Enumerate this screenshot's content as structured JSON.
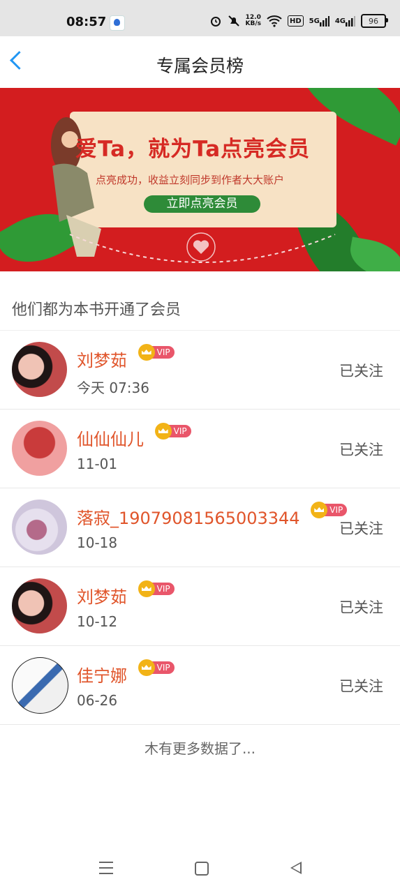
{
  "statusbar": {
    "time": "08:57",
    "speed": "12.0\nKB/s",
    "network1": "5G",
    "network2": "4G",
    "hd": "HD",
    "battery": "96",
    "icons": [
      "baidu-app-icon",
      "alarm-icon",
      "mute-icon",
      "wifi-icon",
      "hd-icon",
      "signal-5g-icon",
      "signal-4g-icon",
      "battery-icon"
    ]
  },
  "header": {
    "title": "专属会员榜",
    "back_icon": "chevron-left-icon"
  },
  "banner": {
    "headline": "爱Ta，就为Ta点亮会员",
    "subtitle": "点亮成功，收益立刻同步到作者大大账户",
    "button": "立即点亮会员"
  },
  "section": {
    "title": "他们都为本书开通了会员"
  },
  "vip_label": "VIP",
  "members": [
    {
      "name": "刘梦茹",
      "date": "今天 07:36",
      "status": "已关注",
      "avatar_colors": [
        "#3a2222",
        "#c24b4b"
      ]
    },
    {
      "name": "仙仙仙儿",
      "date": "11-01",
      "status": "已关注",
      "avatar_colors": [
        "#e88a8a",
        "#d44a4a"
      ]
    },
    {
      "name": "落寂_19079081565003344",
      "date": "10-18",
      "status": "已关注",
      "avatar_colors": [
        "#d8d4e4",
        "#8a7a9a"
      ]
    },
    {
      "name": "刘梦茹",
      "date": "10-12",
      "status": "已关注",
      "avatar_colors": [
        "#3a2222",
        "#c24b4b"
      ]
    },
    {
      "name": "佳宁娜",
      "date": "06-26",
      "status": "已关注",
      "avatar_colors": [
        "#f4f4f4",
        "#3a6ab0"
      ]
    }
  ],
  "footer": {
    "no_more": "木有更多数据了..."
  },
  "colors": {
    "accent": "#2196f3",
    "name": "#e0552b",
    "banner_red": "#d31d1f",
    "banner_green": "#2e8b38"
  }
}
